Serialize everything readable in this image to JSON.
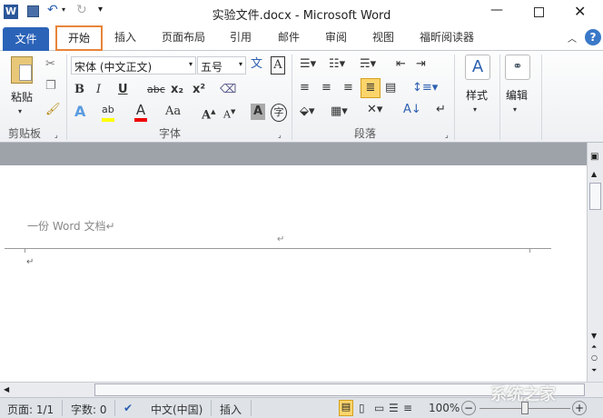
{
  "title": "实验文件.docx - Microsoft Word",
  "tabs": [
    {
      "label": "文件"
    },
    {
      "label": "开始"
    },
    {
      "label": "插入"
    },
    {
      "label": "页面布局"
    },
    {
      "label": "引用"
    },
    {
      "label": "邮件"
    },
    {
      "label": "审阅"
    },
    {
      "label": "视图"
    },
    {
      "label": "福昕阅读器"
    }
  ],
  "active_tab": "开始",
  "accent": "#2b579a",
  "highlight_color": "#e8843a",
  "ribbon": {
    "clipboard": {
      "label": "剪贴板",
      "paste": "粘贴"
    },
    "font": {
      "label": "字体",
      "font_name": "宋体 (中文正文)",
      "font_size": "五号"
    },
    "paragraph": {
      "label": "段落"
    },
    "styles": {
      "label": "样式"
    },
    "editing": {
      "label": "编辑"
    }
  },
  "document": {
    "text": "一份 Word 文档",
    "para_mark": "↵"
  },
  "status": {
    "page": "页面: 1/1",
    "words": "字数: 0",
    "language": "中文(中国)",
    "mode": "插入",
    "zoom": "100%"
  },
  "watermark": "系统之家"
}
